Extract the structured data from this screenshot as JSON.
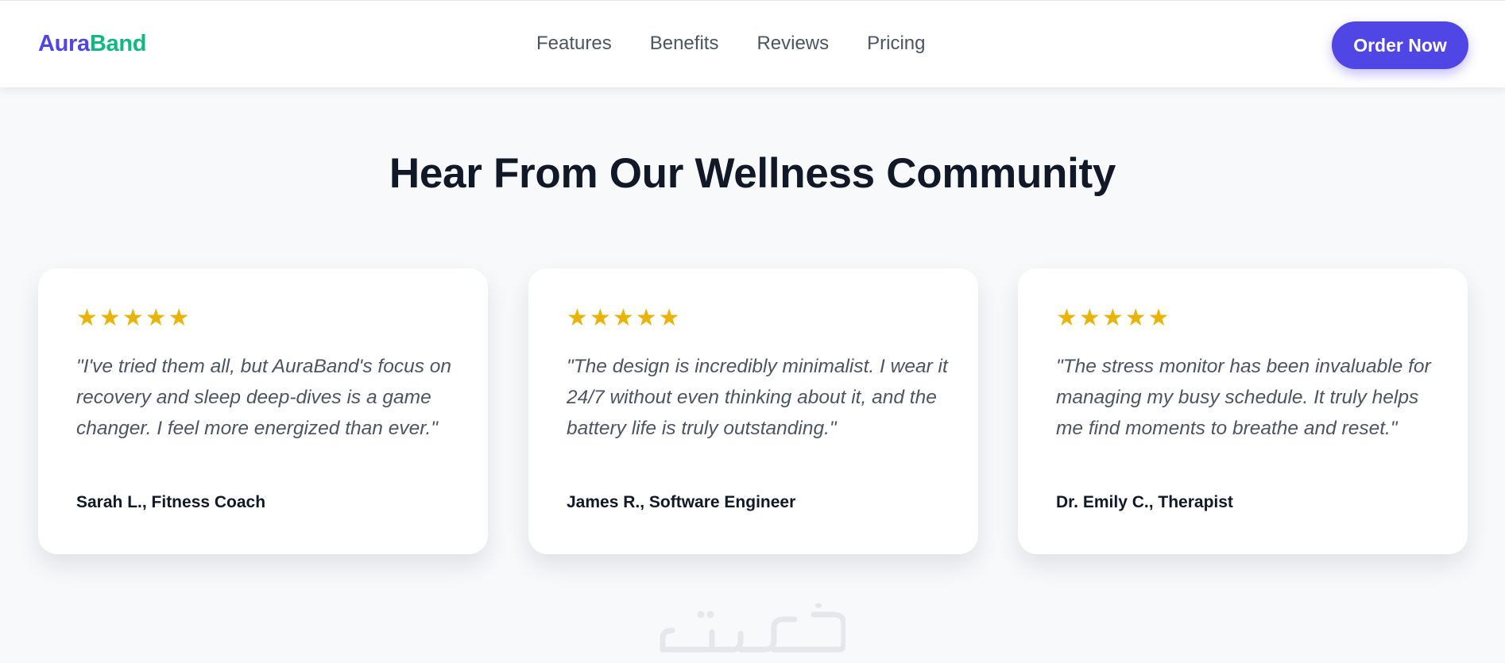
{
  "header": {
    "logo_part1": "Aura",
    "logo_part2": "Band",
    "nav": [
      "Features",
      "Benefits",
      "Reviews",
      "Pricing"
    ],
    "cta_label": "Order Now"
  },
  "testimonials": {
    "title": "Hear From Our Wellness Community",
    "items": [
      {
        "rating": 5,
        "quote": "\"I've tried them all, but AuraBand's focus on recovery and sleep deep-dives is a game changer. I feel more energized than ever.\"",
        "author": "Sarah L., Fitness Coach"
      },
      {
        "rating": 5,
        "quote": "\"The design is incredibly minimalist. I wear it 24/7 without even thinking about it, and the battery life is truly outstanding.\"",
        "author": "James R., Software Engineer"
      },
      {
        "rating": 5,
        "quote": "\"The stress monitor has been invaluable for managing my busy schedule. It truly helps me find moments to breathe and reset.\"",
        "author": "Dr. Emily C., Therapist"
      }
    ]
  },
  "colors": {
    "brand_primary": "#4f46e5",
    "brand_secondary": "#10b981",
    "star": "#eab308",
    "page_background": "#f8f9fb"
  },
  "icons": {
    "rating": "star-icon"
  },
  "watermark": {
    "text": "خمسات"
  }
}
